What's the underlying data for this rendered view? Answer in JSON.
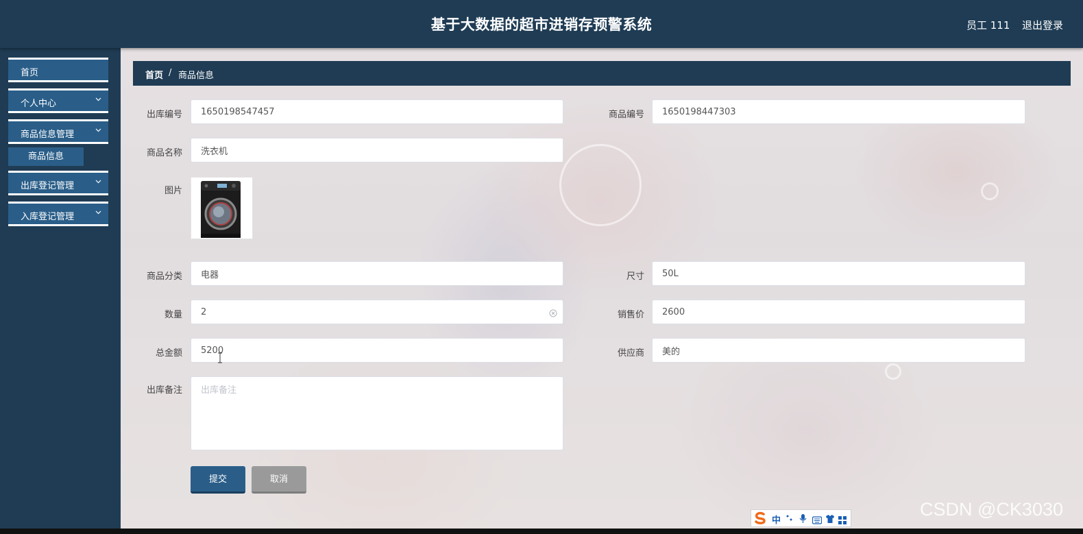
{
  "header": {
    "title": "基于大数据的超市进销存预警系统",
    "user": "员工 111",
    "logout": "退出登录"
  },
  "sidebar": {
    "items": [
      {
        "label": "首页",
        "has_submenu": false
      },
      {
        "label": "个人中心",
        "has_submenu": true
      },
      {
        "label": "商品信息管理",
        "has_submenu": true
      },
      {
        "label": "出库登记管理",
        "has_submenu": true
      },
      {
        "label": "入库登记管理",
        "has_submenu": true
      }
    ],
    "submenu_item": "商品信息"
  },
  "breadcrumb": {
    "home": "首页",
    "separator": "/",
    "current": "商品信息"
  },
  "form": {
    "out_no": {
      "label": "出库编号",
      "value": "1650198547457"
    },
    "product_no": {
      "label": "商品编号",
      "value": "1650198447303"
    },
    "product_name": {
      "label": "商品名称",
      "value": "洗衣机"
    },
    "image": {
      "label": "图片",
      "alt": "washing-machine-image"
    },
    "category": {
      "label": "商品分类",
      "value": "电器"
    },
    "size": {
      "label": "尺寸",
      "value": "50L"
    },
    "quantity": {
      "label": "数量",
      "value": "2"
    },
    "price": {
      "label": "销售价",
      "value": "2600"
    },
    "total": {
      "label": "总金额",
      "value": "5200"
    },
    "supplier": {
      "label": "供应商",
      "value": "美的"
    },
    "remark": {
      "label": "出库备注",
      "placeholder": "出库备注",
      "value": ""
    }
  },
  "buttons": {
    "submit": "提交",
    "cancel": "取消"
  },
  "ime": {
    "mode": "中",
    "icons": [
      "sogou-logo-icon",
      "punctuation-icon",
      "microphone-icon",
      "keyboard-icon",
      "skin-icon",
      "toolbox-icon"
    ]
  },
  "watermark": "CSDN @CK3030",
  "colors": {
    "primary": "#2a5e89",
    "header": "#1f3c54",
    "cancel": "#9a9a9a"
  }
}
